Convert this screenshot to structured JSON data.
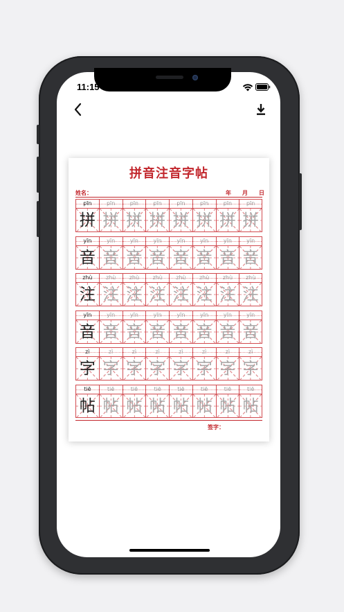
{
  "status_bar": {
    "time": "11:15"
  },
  "nav": {
    "back_icon": "chevron-left-icon",
    "download_icon": "download-icon"
  },
  "worksheet": {
    "title": "拼音注音字帖",
    "name_label": "姓名：",
    "date_labels": [
      "年",
      "月",
      "日"
    ],
    "sign_label": "签字：",
    "rows": [
      {
        "pinyin": "pīn",
        "char": "拼"
      },
      {
        "pinyin": "yīn",
        "char": "音"
      },
      {
        "pinyin": "zhù",
        "char": "注"
      },
      {
        "pinyin": "yīn",
        "char": "音"
      },
      {
        "pinyin": "zì",
        "char": "字"
      },
      {
        "pinyin": "tiē",
        "char": "帖"
      }
    ],
    "columns_per_row": 8
  },
  "colors": {
    "accent_red": "#c2272d",
    "grid_red": "#d14a4f",
    "trace_gray": "#a8a8a8"
  }
}
